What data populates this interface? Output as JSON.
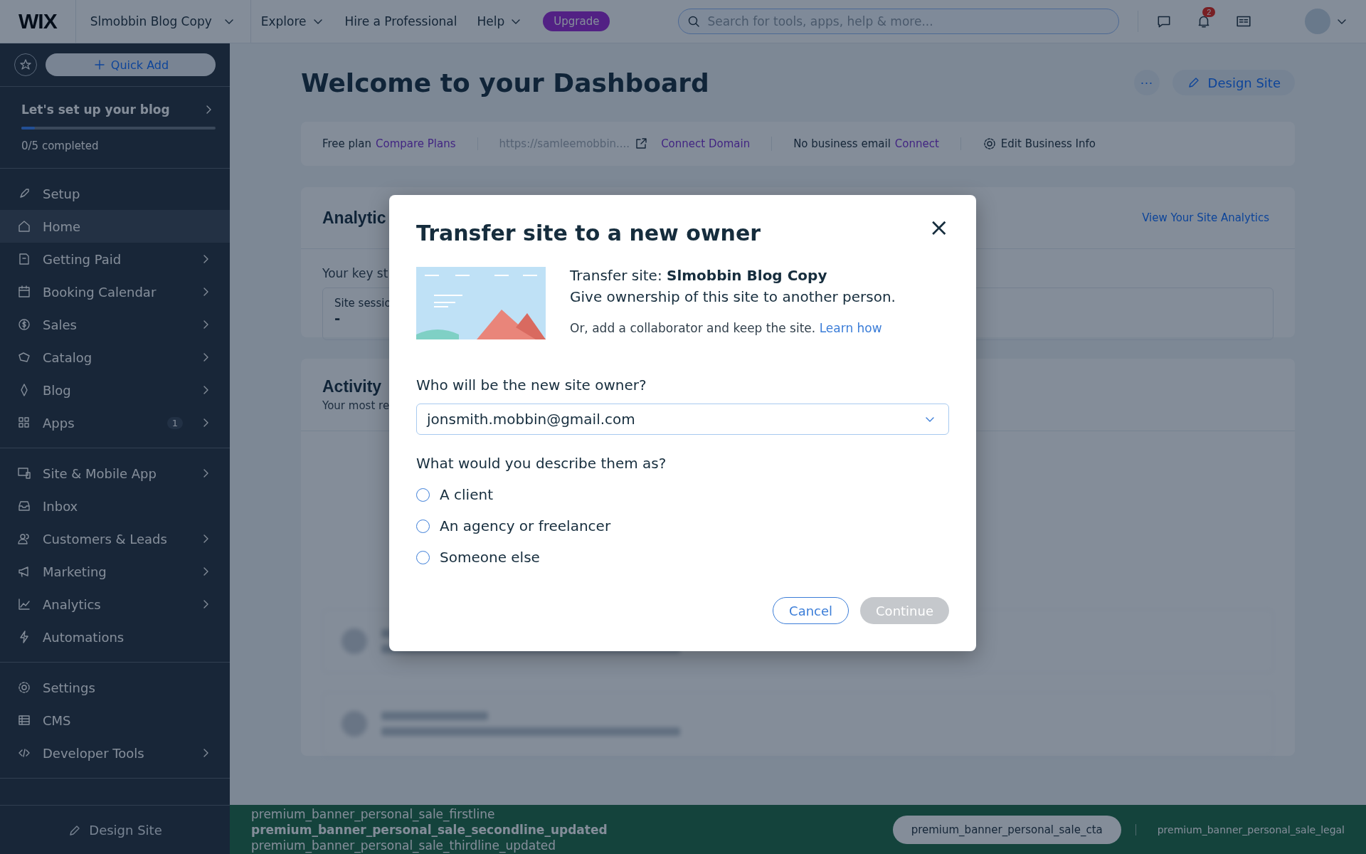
{
  "topbar": {
    "logo": "WIX",
    "site_name": "Slmobbin Blog Copy",
    "nav": [
      {
        "label": "Explore",
        "caret": true
      },
      {
        "label": "Hire a Professional",
        "caret": false
      },
      {
        "label": "Help",
        "caret": true
      }
    ],
    "upgrade": "Upgrade",
    "search": {
      "placeholder": "Search for tools, apps, help & more..."
    },
    "notifications": "2"
  },
  "sidebar": {
    "quick_add": "Quick Add",
    "setup": {
      "title": "Let's set up your blog",
      "level": 0.07,
      "progress": "0/5 completed"
    },
    "sections": [
      {
        "items": [
          {
            "label": "Setup",
            "selected": false,
            "chevron": false
          },
          {
            "label": "Home",
            "selected": true,
            "chevron": false
          },
          {
            "label": "Getting Paid",
            "selected": false,
            "chevron": true
          },
          {
            "label": "Booking Calendar",
            "selected": false,
            "chevron": true
          },
          {
            "label": "Sales",
            "selected": false,
            "chevron": true
          },
          {
            "label": "Catalog",
            "selected": false,
            "chevron": true
          },
          {
            "label": "Blog",
            "selected": false,
            "chevron": true
          },
          {
            "label": "Apps",
            "selected": false,
            "chevron": true,
            "badge": "1"
          }
        ]
      },
      {
        "items": [
          {
            "label": "Site & Mobile App",
            "selected": false,
            "chevron": true
          },
          {
            "label": "Inbox",
            "selected": false,
            "chevron": false
          },
          {
            "label": "Customers & Leads",
            "selected": false,
            "chevron": true
          },
          {
            "label": "Marketing",
            "selected": false,
            "chevron": true
          },
          {
            "label": "Analytics",
            "selected": false,
            "chevron": true
          },
          {
            "label": "Automations",
            "selected": false,
            "chevron": false
          }
        ]
      },
      {
        "items": [
          {
            "label": "Settings",
            "selected": false,
            "chevron": false
          },
          {
            "label": "CMS",
            "selected": false,
            "chevron": false
          },
          {
            "label": "Developer Tools",
            "selected": false,
            "chevron": true
          }
        ]
      }
    ],
    "footer": "Design Site"
  },
  "main": {
    "title": "Welcome to your Dashboard",
    "more": "···",
    "design_site": "Design Site",
    "info_bar": {
      "plan": "Free plan",
      "compare": "Compare Plans",
      "url": "https://samleemobbin....",
      "connect_domain": "Connect Domain",
      "email": "No business email",
      "connect": "Connect",
      "edit": "Edit Business Info"
    },
    "analytics": {
      "title": "Analytic",
      "link": "View Your Site Analytics",
      "subtitle": "Your key st",
      "stat_label": "Site sessio",
      "stat_value": "-"
    },
    "activity": {
      "title": "Activity",
      "subtitle": "Your most re"
    }
  },
  "modal": {
    "title": "Transfer site to a new owner",
    "close": "×",
    "transfer_line": "Transfer site: **Slmobbin Blog Copy**",
    "give_line": "Give ownership of this site to another person.",
    "collab_line": "Or, add a collaborator and keep the site.",
    "learn_how": "Learn how",
    "owner_label": "Who will be the new site owner?",
    "owner_value": "jonsmith.mobbin@gmail.com",
    "describe_label": "What would you describe them as?",
    "options": [
      {
        "label": "A client",
        "selected": false
      },
      {
        "label": "An agency or freelancer",
        "selected": false
      },
      {
        "label": "Someone else",
        "selected": false
      }
    ],
    "cancel": "Cancel",
    "continue": {
      "label": "Continue",
      "disabled": true
    }
  },
  "banner": {
    "firstline": "premium_banner_personal_sale_firstline",
    "secondline": "premium_banner_personal_sale_secondline_updated",
    "thirdline": "premium_banner_personal_sale_thirdline_updated",
    "cta": "premium_banner_personal_sale_cta",
    "legal": "premium_banner_personal_sale_legal"
  }
}
